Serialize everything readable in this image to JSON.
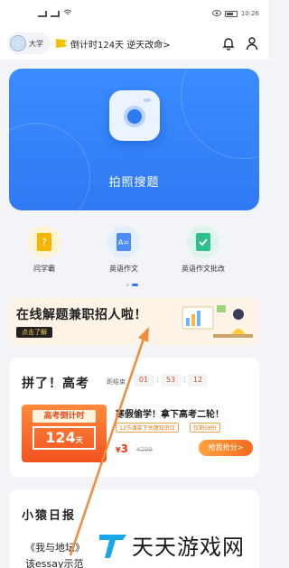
{
  "status_bar": {
    "time": "10:26"
  },
  "top_bar": {
    "grade": "大学",
    "countdown": "倒计时124天 逆天改命>"
  },
  "photo_search": {
    "label": "拍照搜题"
  },
  "features": [
    {
      "label": "问学霸",
      "icon": "question-book-icon",
      "color": "#f5b400"
    },
    {
      "label": "英语作文",
      "icon": "english-book-icon",
      "color": "#4a8ef5"
    },
    {
      "label": "英语作文批改",
      "icon": "check-book-icon",
      "color": "#2fbf8a"
    }
  ],
  "banner": {
    "title": "在线解题兼职招人啦！",
    "button": "点击了解"
  },
  "gaokao": {
    "title": "拼了！高考",
    "timer_label": "距结束",
    "timer": [
      "01",
      "53",
      "12"
    ],
    "cover_title": "高考倒计时",
    "cover_days": "124",
    "cover_unit": "天",
    "product_name": "寒假偷学！拿下高考二轮！",
    "tags": [
      "12节课拿下关键知识点",
      "仅剩58份"
    ],
    "price_currency": "¥",
    "price": "3",
    "original_price": "¥299",
    "buy_button": "抢我抢分>"
  },
  "diary": {
    "title": "小猿日报",
    "line1": "《我与地坛》",
    "line2": "该essay示范"
  },
  "watermark": {
    "text": "天天游戏网"
  },
  "colors": {
    "primary": "#2f7af3",
    "accent": "#f26a1f",
    "price": "#e83a1c"
  }
}
